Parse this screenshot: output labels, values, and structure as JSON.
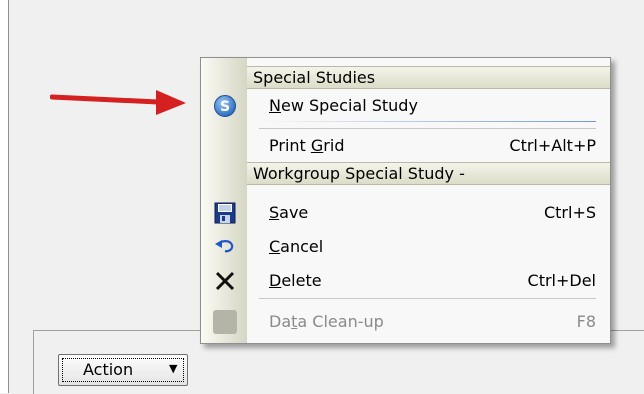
{
  "action_button": {
    "label": "Action"
  },
  "menu": {
    "sections": [
      {
        "header": "Special Studies",
        "items": [
          {
            "mnemonic": "N",
            "rest": "ew Special Study",
            "shortcut": "",
            "icon": "special-study-icon",
            "enabled": true
          },
          {
            "pre": "Print ",
            "mnemonic": "G",
            "rest": "rid",
            "shortcut": "Ctrl+Alt+P",
            "enabled": true
          }
        ]
      },
      {
        "header": "Workgroup Special Study -",
        "items": [
          {
            "mnemonic": "S",
            "rest": "ave",
            "shortcut": "Ctrl+S",
            "icon": "save-icon",
            "enabled": true
          },
          {
            "mnemonic": "C",
            "rest": "ancel",
            "shortcut": "",
            "icon": "undo-icon",
            "enabled": true
          },
          {
            "mnemonic": "D",
            "rest": "elete",
            "shortcut": "Ctrl+Del",
            "icon": "delete-icon",
            "enabled": true
          },
          {
            "pre": "Da",
            "mnemonic": "t",
            "rest": "a Clean-up",
            "shortcut": "F8",
            "icon": "clean-up-icon",
            "enabled": false
          }
        ]
      }
    ]
  },
  "colors": {
    "arrow": "#d42020",
    "header_bg": "#dcdcc8",
    "disabled_text": "#8a8a8a",
    "special_study_icon": "#3a7fd0",
    "save_icon": "#1a3a8a"
  }
}
